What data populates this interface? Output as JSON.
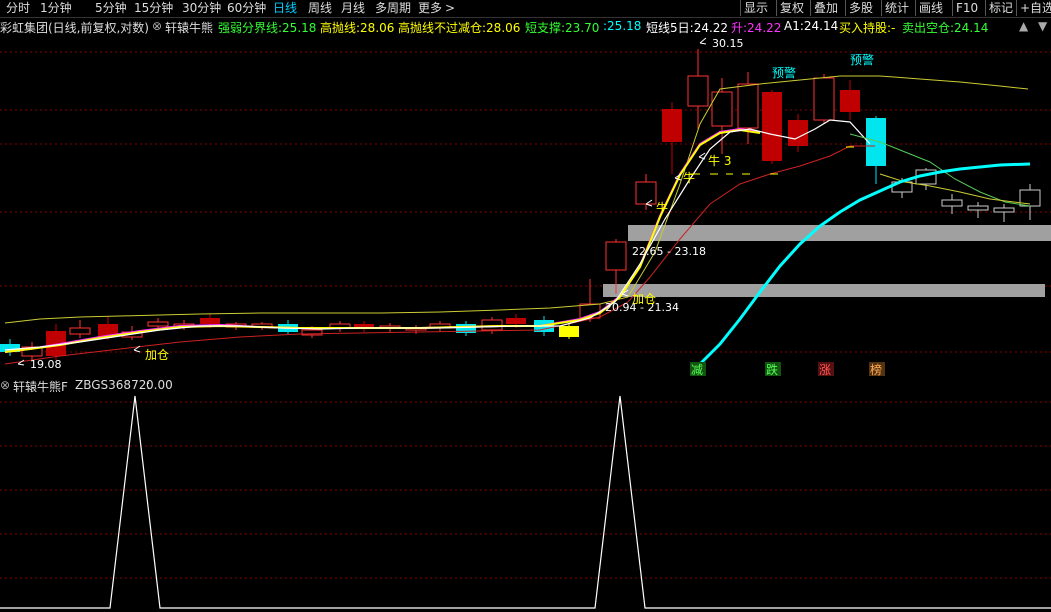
{
  "toolbar": {
    "period_tabs": [
      "分时",
      "1分钟",
      "5分钟",
      "15分钟",
      "30分钟",
      "60分钟",
      "日线",
      "周线",
      "月线",
      "多周期",
      "更多"
    ],
    "more_arrow": ">",
    "right_buttons": [
      "显示",
      "复权",
      "叠加",
      "多股",
      "统计",
      "画线",
      "F10",
      "标记",
      "+自选"
    ]
  },
  "legend": {
    "stock": "彩虹集团(日线,前复权,对数)",
    "indicator": "轩辕牛熊",
    "items": [
      {
        "label": "强弱分界线:",
        "value": "25.18",
        "color": "#33ff33"
      },
      {
        "label": "高抛线:",
        "value": "28.06",
        "color": "#ffff00"
      },
      {
        "label": "高抛线不过减仓:",
        "value": "28.06",
        "color": "#ffff00"
      },
      {
        "label": "短支撑:",
        "value": "23.70",
        "color": "#33ff33"
      },
      {
        "label": ":",
        "value": "25.18",
        "color": "#00ffff"
      },
      {
        "label": "短线5日:",
        "value": "24.22",
        "color": "#ffffff"
      },
      {
        "label": "升:",
        "value": "24.22",
        "color": "#ff33ff"
      },
      {
        "label": "A1:",
        "value": "24.14",
        "color": "#ffffff"
      },
      {
        "label": "买入持股:",
        "value": "-",
        "color": "#ffff00"
      },
      {
        "label": "卖出空仓:",
        "value": "24.14",
        "color": "#33ff33"
      }
    ]
  },
  "annotations": {
    "high_price": "30.15",
    "low_price": "19.08",
    "zone_upper": "22.65 - 23.18",
    "zone_lower": "20.94 - 21.34",
    "add_position_1": "加仓",
    "add_position_2": "加仓",
    "warning_1": "预警",
    "warning_2": "预警",
    "bull_1": "牛",
    "bull_2": "牛",
    "bull_3": "牛 3"
  },
  "signals": {
    "reduce": "减",
    "fall": "跌",
    "rise": "涨",
    "rank": "榜"
  },
  "sub_panel": {
    "title": "轩辕牛熊F",
    "value_label": "ZBGS36872:",
    "value": "0.00"
  },
  "colors": {
    "up": "#ff3232",
    "down": "#00ffff",
    "bull_yellow": "#ffff00",
    "grid": "#8b0000"
  }
}
